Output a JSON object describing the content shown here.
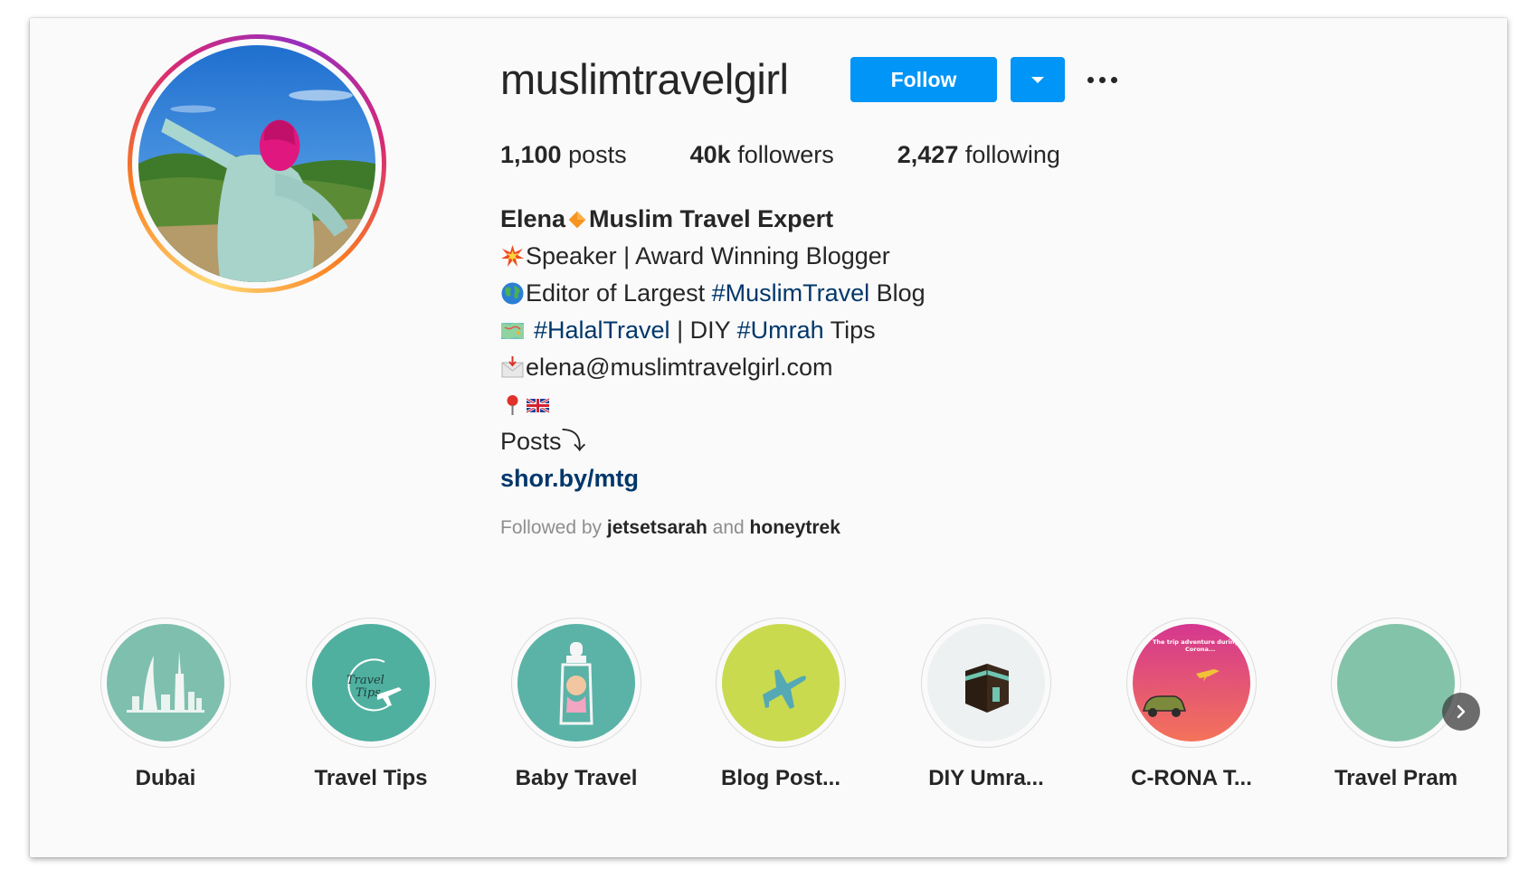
{
  "profile": {
    "username": "muslimtravelgirl",
    "follow_label": "Follow",
    "stats": {
      "posts_count": "1,100",
      "posts_label": "posts",
      "followers_count": "40k",
      "followers_label": "followers",
      "following_count": "2,427",
      "following_label": "following"
    },
    "bio": {
      "name_part1": "Elena",
      "name_part2": "Muslim Travel Expert",
      "line1": "Speaker | Award Winning Blogger",
      "line2_pre": "Editor of Largest ",
      "line2_tag": "#MuslimTravel",
      "line2_post": " Blog",
      "line3_tag1": "#HalalTravel",
      "line3_mid": " | DIY ",
      "line3_tag2": "#Umrah",
      "line3_post": " Tips",
      "email": "elena@muslimtravelgirl.com",
      "posts_text": "Posts⤵",
      "link": "shor.by/mtg"
    },
    "followed_by": {
      "prefix": "Followed by",
      "user1": "jetsetsarah",
      "conjunction": "and",
      "user2": "honeytrek"
    }
  },
  "highlights": [
    {
      "label": "Dubai",
      "color": "#7fbfae"
    },
    {
      "label": "Travel Tips",
      "color": "#4fb0a0"
    },
    {
      "label": "Baby Travel",
      "color": "#5ab3a6"
    },
    {
      "label": "Blog Post...",
      "color": "#c9da4f"
    },
    {
      "label": "DIY Umra...",
      "color": "#eef1f1"
    },
    {
      "label": "C-RONA T...",
      "color": "#e8457f"
    },
    {
      "label": "Travel Pram",
      "color": "#83c3aa"
    }
  ],
  "highlight_cover_texts": {
    "travel_tips": [
      "Travel",
      "Tips"
    ],
    "corona": [
      "The trip adventure during",
      "Corona..."
    ]
  },
  "colors": {
    "accent": "#0095f6",
    "hashtag": "#00376b",
    "text": "#262626",
    "muted": "#8e8e8e"
  }
}
